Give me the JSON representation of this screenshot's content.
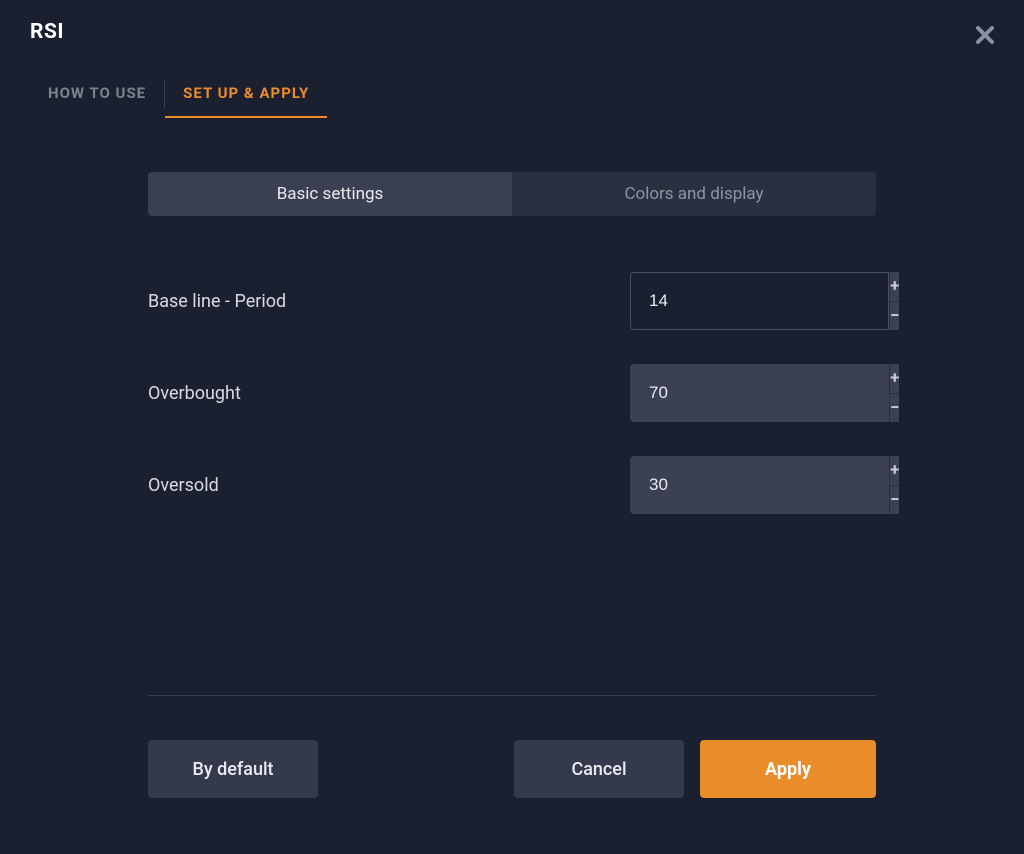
{
  "title": "RSI",
  "tabs": {
    "how_to_use": "HOW TO USE",
    "set_up": "SET UP & APPLY"
  },
  "segmented": {
    "basic": "Basic settings",
    "colors": "Colors and display"
  },
  "fields": {
    "baseline": {
      "label": "Base line - Period",
      "value": "14"
    },
    "overbought": {
      "label": "Overbought",
      "value": "70"
    },
    "oversold": {
      "label": "Oversold",
      "value": "30"
    }
  },
  "buttons": {
    "default": "By default",
    "cancel": "Cancel",
    "apply": "Apply"
  },
  "icons": {
    "plus": "+",
    "minus": "−"
  }
}
